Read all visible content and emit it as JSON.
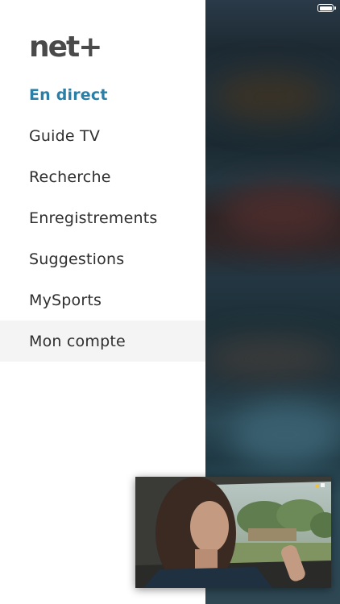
{
  "app": {
    "logo_text": "net+"
  },
  "nav": {
    "items": [
      {
        "label": "En direct",
        "state": "active"
      },
      {
        "label": "Guide TV",
        "state": ""
      },
      {
        "label": "Recherche",
        "state": ""
      },
      {
        "label": "Enregistrements",
        "state": ""
      },
      {
        "label": "Suggestions",
        "state": ""
      },
      {
        "label": "MySports",
        "state": ""
      },
      {
        "label": "Mon compte",
        "state": "selected"
      }
    ]
  },
  "colors": {
    "accent": "#2a7fa6",
    "text": "#2f2f2f",
    "logo": "#4a4a4a"
  },
  "icons": {
    "battery": "battery-icon",
    "pip": "picture-in-picture-video"
  }
}
